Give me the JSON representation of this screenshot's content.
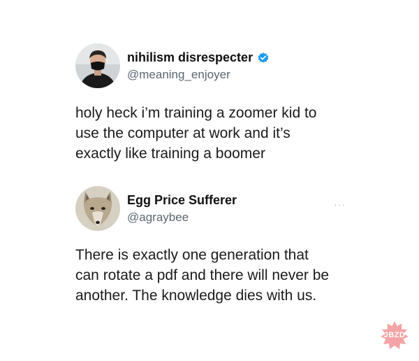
{
  "tweets": [
    {
      "display_name": "nihilism disrespecter",
      "handle": "@meaning_enjoyer",
      "verified": true,
      "avatar_icon": "man-in-black-mask-avatar",
      "lines": [
        "holy heck i’m training a zoomer kid to",
        "use the computer at work and it’s",
        "exactly like training a boomer"
      ]
    },
    {
      "display_name": "Egg Price Sufferer",
      "handle": "@agraybee",
      "verified": false,
      "avatar_icon": "coyote-avatar",
      "more_label": "···",
      "lines": [
        "There is exactly one generation that",
        "can rotate a pdf and there will never be",
        "another. The knowledge dies with us."
      ]
    }
  ],
  "watermark": {
    "text": "JBZD",
    "color": "#f4a3a6"
  },
  "colors": {
    "verified": "#1d9bf0",
    "handle": "#5b6670"
  }
}
